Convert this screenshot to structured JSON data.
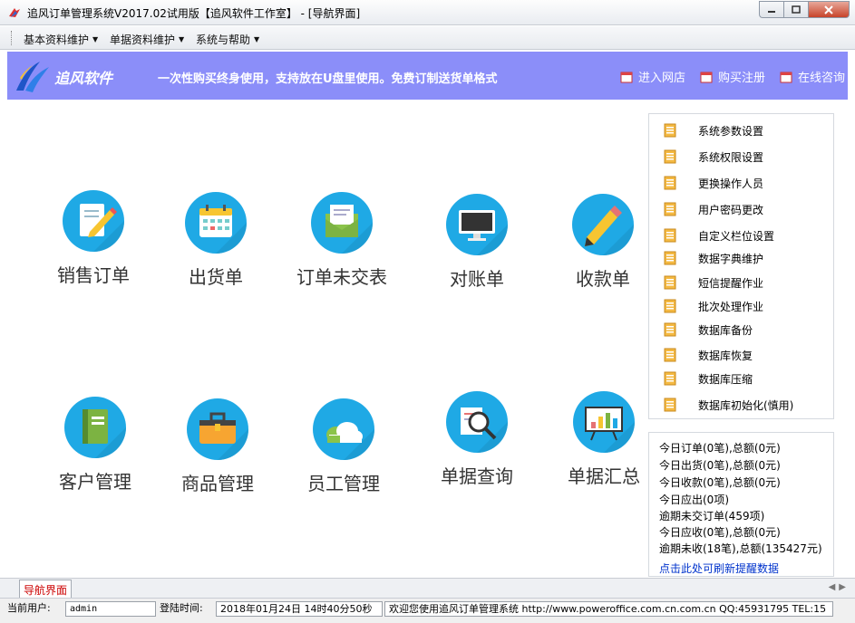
{
  "window": {
    "title": "追风订单管理系统V2017.02试用版【追风软件工作室】 - [导航界面]"
  },
  "menu": {
    "items": [
      {
        "label": "基本资料维护"
      },
      {
        "label": "单据资料维护"
      },
      {
        "label": "系统与帮助"
      }
    ]
  },
  "banner": {
    "logo_text": "追风软件",
    "slogan": "一次性购买终身使用，支持放在U盘里使用。免费订制送货单格式",
    "links": [
      {
        "label": "进入网店"
      },
      {
        "label": "购买注册"
      },
      {
        "label": "在线咨询"
      }
    ],
    "color": "#8b8ef9"
  },
  "tiles": {
    "row1": [
      {
        "label": "销售订单",
        "icon": "pencil-notepad-icon"
      },
      {
        "label": "出货单",
        "icon": "calendar-icon"
      },
      {
        "label": "订单未交表",
        "icon": "envelope-icon"
      },
      {
        "label": "对账单",
        "icon": "monitor-icon"
      },
      {
        "label": "收款单",
        "icon": "pencil-icon"
      }
    ],
    "row2": [
      {
        "label": "客户管理",
        "icon": "notebook-icon"
      },
      {
        "label": "商品管理",
        "icon": "briefcase-icon"
      },
      {
        "label": "员工管理",
        "icon": "cloud-icon"
      },
      {
        "label": "单据查询",
        "icon": "magnifier-icon"
      },
      {
        "label": "单据汇总",
        "icon": "presentation-chart-icon"
      }
    ],
    "accent": "#1fa9e5"
  },
  "right_panel": {
    "items": [
      {
        "label": "系统参数设置"
      },
      {
        "label": "系统权限设置"
      },
      {
        "label": "更换操作人员"
      },
      {
        "label": "用户密码更改"
      },
      {
        "label": "自定义栏位设置"
      },
      {
        "label": "数据字典维护"
      },
      {
        "label": "短信提醒作业"
      },
      {
        "label": "批次处理作业"
      },
      {
        "label": "数据库备份"
      },
      {
        "label": "数据库恢复"
      },
      {
        "label": "数据库压缩"
      },
      {
        "label": "数据库初始化(慎用)"
      }
    ]
  },
  "reminders": {
    "lines": [
      "今日订单(0笔),总额(0元)",
      "今日出货(0笔),总额(0元)",
      "今日收款(0笔),总额(0元)",
      "今日应出(0项)",
      "逾期未交订单(459项)",
      "今日应收(0笔),总额(0元)",
      "逾期未收(18笔),总额(135427元)"
    ],
    "refresh_link": "点击此处可刷新提醒数据"
  },
  "tabs": {
    "active": "导航界面"
  },
  "status": {
    "user_label": "当前用户:",
    "user_value": "admin",
    "login_label": "登陆时间:",
    "login_value": "2018年01月24日 14时40分50秒",
    "welcome": "欢迎您使用追风订单管理系统 http://www.poweroffice.com.cn.com.cn QQ:45931795 TEL:15"
  }
}
